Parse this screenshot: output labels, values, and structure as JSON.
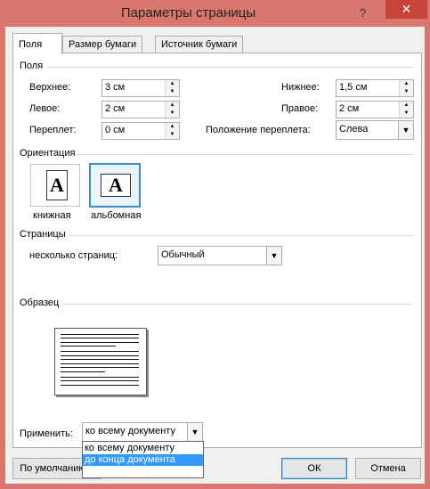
{
  "window": {
    "title": "Параметры страницы",
    "help": "?",
    "close": "✕"
  },
  "tabs": [
    {
      "label": "Поля"
    },
    {
      "label": "Размер бумаги"
    },
    {
      "label": "Источник бумаги"
    }
  ],
  "margins": {
    "group_label": "Поля",
    "top": {
      "label": "Верхнее:",
      "value": "3 см"
    },
    "bottom": {
      "label": "Нижнее:",
      "value": "1,5 см"
    },
    "left": {
      "label": "Левое:",
      "value": "2 см"
    },
    "right": {
      "label": "Правое:",
      "value": "2 см"
    },
    "gutter": {
      "label": "Переплет:",
      "value": "0 см"
    },
    "gutter_position": {
      "label": "Положение переплета:",
      "value": "Слева"
    }
  },
  "orientation": {
    "group_label": "Ориентация",
    "portrait_label": "книжная",
    "landscape_label": "альбомная",
    "icon_letter": "A",
    "selected": "landscape"
  },
  "pages": {
    "group_label": "Страницы",
    "multiple_label": "несколько страниц:",
    "multiple_value": "Обычный"
  },
  "preview": {
    "group_label": "Образец"
  },
  "apply": {
    "label": "Применить:",
    "value": "ко всему документу",
    "options": [
      "ко всему документу",
      "до конца документа"
    ],
    "highlighted_index": 1
  },
  "buttons": {
    "default": "По умолчанию...",
    "ok": "ОК",
    "cancel": "Отмена"
  },
  "colors": {
    "title_bar": "#d9766e",
    "close_button": "#c7443a",
    "selection": "#3399ff"
  }
}
